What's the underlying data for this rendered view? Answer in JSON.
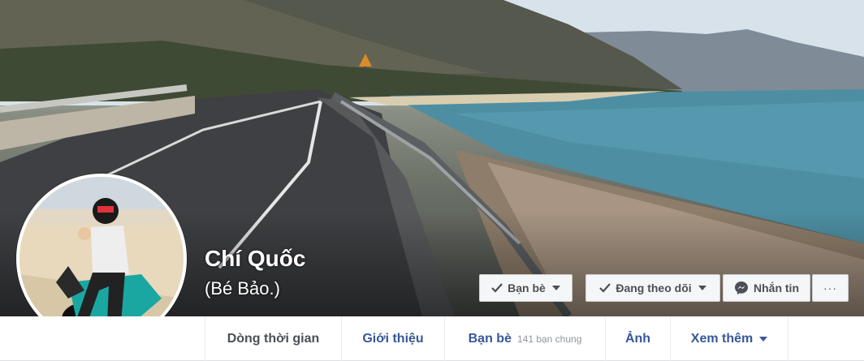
{
  "profile": {
    "name": "Chí Quốc",
    "alternate_name": "(Bé Bảo.)"
  },
  "actions": {
    "friends_label": "Bạn bè",
    "following_label": "Đang theo dõi",
    "message_label": "Nhắn tin",
    "more_label": "···"
  },
  "tabs": {
    "timeline": "Dòng thời gian",
    "about": "Giới thiệu",
    "friends": "Bạn bè",
    "mutual": "141 bạn chung",
    "photos": "Ảnh",
    "more": "Xem thêm"
  },
  "colors": {
    "link": "#365899",
    "button_text": "#4b4f56",
    "messenger": "#4b4f56"
  },
  "icons": {
    "friends": "check-icon",
    "following": "check-icon",
    "message": "messenger-icon",
    "dropdown": "chevron-down-icon"
  }
}
